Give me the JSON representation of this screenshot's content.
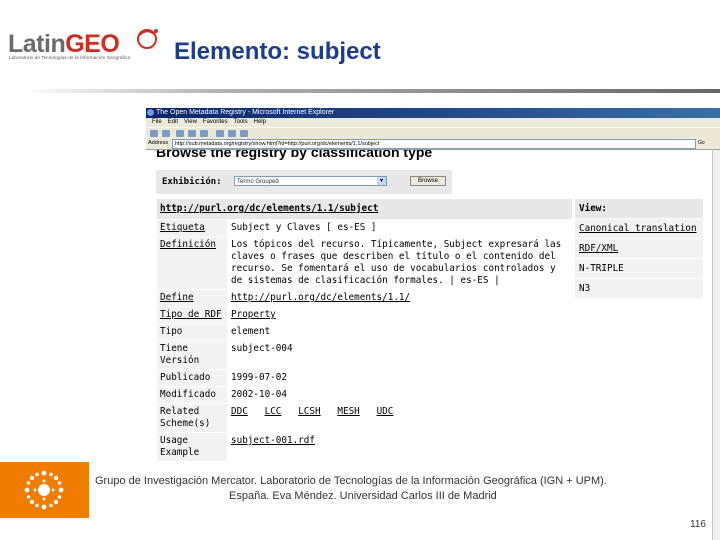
{
  "slide": {
    "logo_latin": "Latin",
    "logo_geo": "GEO",
    "logo_tagline": "Laboratorio de Tecnologías de la Información Geográfica",
    "title": "Elemento: subject",
    "footer_line1": "Grupo de Investigación Mercator. Laboratorio de Tecnologías de la Información Geográfica (IGN + UPM).",
    "footer_line2": "España. Eva Méndez. Universidad Carlos III de Madrid",
    "page_number": "116"
  },
  "browser": {
    "window_title": "The Open Metadata Registry - Microsoft Internet Explorer",
    "menu": [
      "File",
      "Edit",
      "View",
      "Favorites",
      "Tools",
      "Help"
    ],
    "address_label": "Address",
    "address": "http://sub.metadata.org/registry/show.html?id=http://purl.org/dc/elements/1.1/subject",
    "go_label": "Go",
    "page_heading": "Browse the registry by classification type",
    "exhibition": {
      "label": "Exhibición:",
      "selected": "Termo Grouped",
      "button": "Browse"
    },
    "element_uri": "http://purl.org/dc/elements/1.1/subject",
    "rows": [
      {
        "label": "Etiqueta",
        "value": "Subject y Claves [ es-ES ]"
      },
      {
        "label": "Definición",
        "value": "Los tópicos del recurso. Típicamente, Subject expresará las claves o frases que describen el título o el contenido del recurso. Se fomentará el uso de vocabularios controlados y de sistemas de clasificación formales. | es-ES |"
      },
      {
        "label": "Define",
        "value": "http://purl.org/dc/elements/1.1/"
      },
      {
        "label": "Tipo de RDF",
        "value": "Property"
      },
      {
        "label": "Tipo",
        "value": "element"
      },
      {
        "label": "Tiene Versión",
        "value": "subject-004"
      },
      {
        "label": "Publicado",
        "value": "1999-07-02"
      },
      {
        "label": "Modificado",
        "value": "2002-10-04"
      },
      {
        "label": "Related Scheme(s)",
        "schemes": [
          "DDC",
          "LCC",
          "LCSH",
          "MESH",
          "UDC"
        ]
      },
      {
        "label": "Usage Example",
        "value": "subject-001.rdf"
      }
    ],
    "view": {
      "header": "View:",
      "links": [
        "Canonical translation",
        "RDF/XML",
        "N-TRIPLE",
        "N3"
      ]
    }
  },
  "colors": {
    "title_blue": "#1c3c8c",
    "logo_red": "#cf2d1f",
    "footer_orange": "#f07c00"
  }
}
